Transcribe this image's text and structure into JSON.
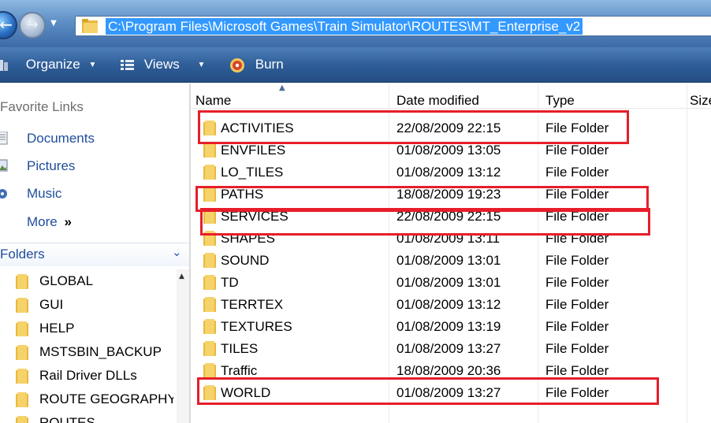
{
  "address": {
    "path": "C:\\Program Files\\Microsoft Games\\Train Simulator\\ROUTES\\MT_Enterprise_v2"
  },
  "icons": {
    "back": "back-arrow-icon",
    "forward": "forward-arrow-icon",
    "folder": "folder-icon",
    "organize": "organize-icon",
    "views": "views-icon",
    "burn": "burn-icon"
  },
  "toolbar": {
    "organize_label": "Organize",
    "views_label": "Views",
    "burn_label": "Burn"
  },
  "nav": {
    "favorite_links_heading": "Favorite Links",
    "links": [
      {
        "label": "Documents"
      },
      {
        "label": "Pictures"
      },
      {
        "label": "Music"
      }
    ],
    "more_label": "More",
    "more_glyph": "»",
    "folders_label": "Folders",
    "folders_glyph": "⌄",
    "tree": [
      {
        "label": "GLOBAL"
      },
      {
        "label": "GUI"
      },
      {
        "label": "HELP"
      },
      {
        "label": "MSTSBIN_BACKUP"
      },
      {
        "label": "Rail Driver DLLs"
      },
      {
        "label": "ROUTE GEOGRAPHY"
      },
      {
        "label": "ROUTES"
      }
    ]
  },
  "columns": {
    "name": "Name",
    "date": "Date modified",
    "type": "Type",
    "size": "Size"
  },
  "files": [
    {
      "name": "ACTIVITIES",
      "date": "22/08/2009 22:15",
      "type": "File Folder"
    },
    {
      "name": "ENVFILES",
      "date": "01/08/2009 13:05",
      "type": "File Folder"
    },
    {
      "name": "LO_TILES",
      "date": "01/08/2009 13:12",
      "type": "File Folder"
    },
    {
      "name": "PATHS",
      "date": "18/08/2009 19:23",
      "type": "File Folder"
    },
    {
      "name": "SERVICES",
      "date": "22/08/2009 22:15",
      "type": "File Folder"
    },
    {
      "name": "SHAPES",
      "date": "01/08/2009 13:11",
      "type": "File Folder"
    },
    {
      "name": "SOUND",
      "date": "01/08/2009 13:01",
      "type": "File Folder"
    },
    {
      "name": "TD",
      "date": "01/08/2009 13:01",
      "type": "File Folder"
    },
    {
      "name": "TERRTEX",
      "date": "01/08/2009 13:12",
      "type": "File Folder"
    },
    {
      "name": "TEXTURES",
      "date": "01/08/2009 13:19",
      "type": "File Folder"
    },
    {
      "name": "TILES",
      "date": "01/08/2009 13:27",
      "type": "File Folder"
    },
    {
      "name": "Traffic",
      "date": "18/08/2009 20:36",
      "type": "File Folder"
    },
    {
      "name": "WORLD",
      "date": "01/08/2009 13:27",
      "type": "File Folder"
    }
  ],
  "colors": {
    "highlight": "#e61e2a",
    "selection": "#3399ff",
    "link": "#1e4d9b"
  }
}
